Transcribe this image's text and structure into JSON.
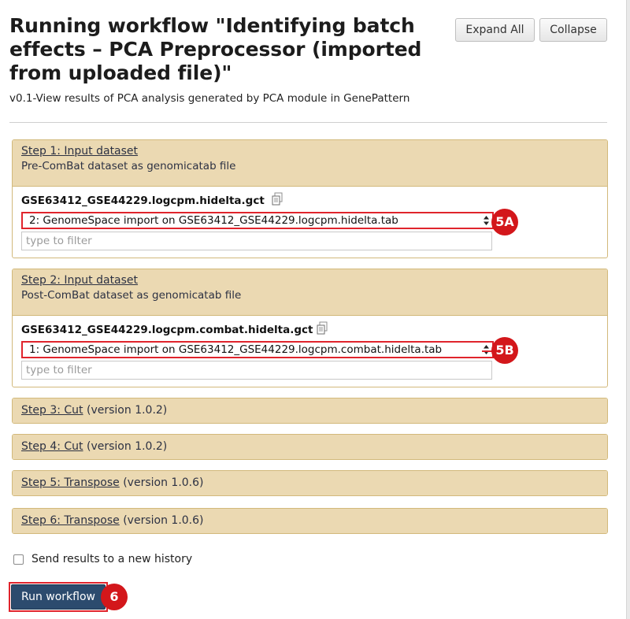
{
  "header": {
    "title": "Running workflow \"Identifying batch effects – PCA Preprocessor (imported from uploaded file)\"",
    "expand_all": "Expand All",
    "collapse": "Collapse",
    "annotation": "v0.1-View results of PCA analysis generated by PCA module in GenePattern"
  },
  "steps": [
    {
      "title": "Step 1: Input dataset",
      "description": "Pre-ComBat dataset as genomicatab file",
      "input_label": "GSE63412_GSE44229.logcpm.hidelta.gct",
      "selected": "2: GenomeSpace import on GSE63412_GSE44229.logcpm.hidelta.tab",
      "filter_placeholder": "type to filter",
      "badge": "5A"
    },
    {
      "title": "Step 2: Input dataset",
      "description": "Post-ComBat dataset as genomicatab file",
      "input_label": "GSE63412_GSE44229.logcpm.combat.hidelta.gct",
      "selected": "1: GenomeSpace import on GSE63412_GSE44229.logcpm.combat.hidelta.tab",
      "filter_placeholder": "type to filter",
      "badge": "5B"
    },
    {
      "title": "Step 3: Cut",
      "version": "(version 1.0.2)"
    },
    {
      "title": "Step 4: Cut",
      "version": "(version 1.0.2)"
    },
    {
      "title": "Step 5: Transpose",
      "version": "(version 1.0.6)"
    },
    {
      "title": "Step 6: Transpose",
      "version": "(version 1.0.6)"
    }
  ],
  "options": {
    "send_to_new_history": "Send results to a new history"
  },
  "run": {
    "label": "Run workflow",
    "badge": "6"
  },
  "colors": {
    "step_header": "#ebd9b2",
    "step_border": "#d2b97b",
    "highlight": "#e0242c",
    "badge": "#d3171b",
    "run_button": "#2c4b6e"
  }
}
